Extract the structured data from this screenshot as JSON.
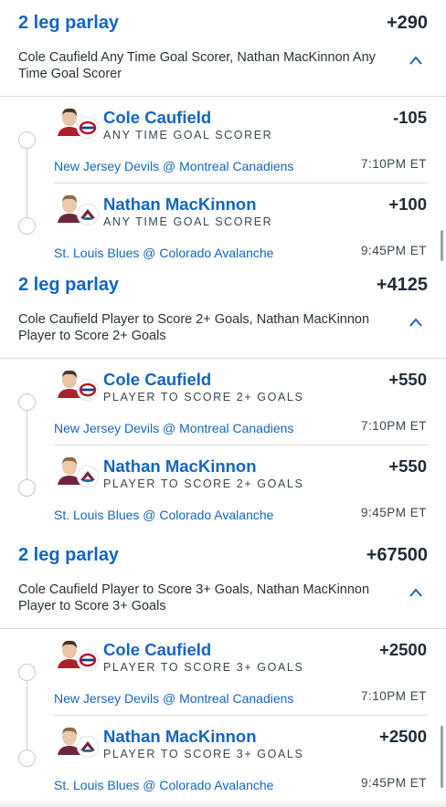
{
  "parlays": [
    {
      "title": "2 leg parlay",
      "odds": "+290",
      "description": "Cole Caufield Any Time Goal Scorer, Nathan MacKinnon Any Time Goal Scorer",
      "collapse_icon": "chevron-up-icon",
      "legs": [
        {
          "player": "Cole Caufield",
          "market": "ANY TIME GOAL SCORER",
          "odds": "-105",
          "game": "New Jersey Devils @ Montreal Canadiens",
          "time": "7:10PM ET",
          "team_logo": "canadiens-logo-icon"
        },
        {
          "player": "Nathan MacKinnon",
          "market": "ANY TIME GOAL SCORER",
          "odds": "+100",
          "game": "St. Louis Blues @ Colorado Avalanche",
          "time": "9:45PM ET",
          "team_logo": "avalanche-logo-icon"
        }
      ]
    },
    {
      "title": "2 leg parlay",
      "odds": "+4125",
      "description": "Cole Caufield Player to Score 2+ Goals, Nathan MacKinnon Player to Score 2+ Goals",
      "collapse_icon": "chevron-up-icon",
      "legs": [
        {
          "player": "Cole Caufield",
          "market": "PLAYER TO SCORE 2+ GOALS",
          "odds": "+550",
          "game": "New Jersey Devils @ Montreal Canadiens",
          "time": "7:10PM ET",
          "team_logo": "canadiens-logo-icon"
        },
        {
          "player": "Nathan MacKinnon",
          "market": "PLAYER TO SCORE 2+ GOALS",
          "odds": "+550",
          "game": "St. Louis Blues @ Colorado Avalanche",
          "time": "9:45PM ET",
          "team_logo": "avalanche-logo-icon"
        }
      ]
    },
    {
      "title": "2 leg parlay",
      "odds": "+67500",
      "description": "Cole Caufield Player to Score 3+ Goals, Nathan MacKinnon Player to Score 3+ Goals",
      "collapse_icon": "chevron-up-icon",
      "legs": [
        {
          "player": "Cole Caufield",
          "market": "PLAYER TO SCORE 3+ GOALS",
          "odds": "+2500",
          "game": "New Jersey Devils @ Montreal Canadiens",
          "time": "7:10PM ET",
          "team_logo": "canadiens-logo-icon"
        },
        {
          "player": "Nathan MacKinnon",
          "market": "PLAYER TO SCORE 3+ GOALS",
          "odds": "+2500",
          "game": "St. Louis Blues @ Colorado Avalanche",
          "time": "9:45PM ET",
          "team_logo": "avalanche-logo-icon"
        }
      ]
    }
  ],
  "colors": {
    "accent_blue": "#1565c0",
    "text_dark": "#1f2a37",
    "divider": "#d9dde2",
    "canadiens_red": "#af1e2d",
    "avalanche_burgundy": "#6f263d",
    "avalanche_blue": "#236192"
  }
}
